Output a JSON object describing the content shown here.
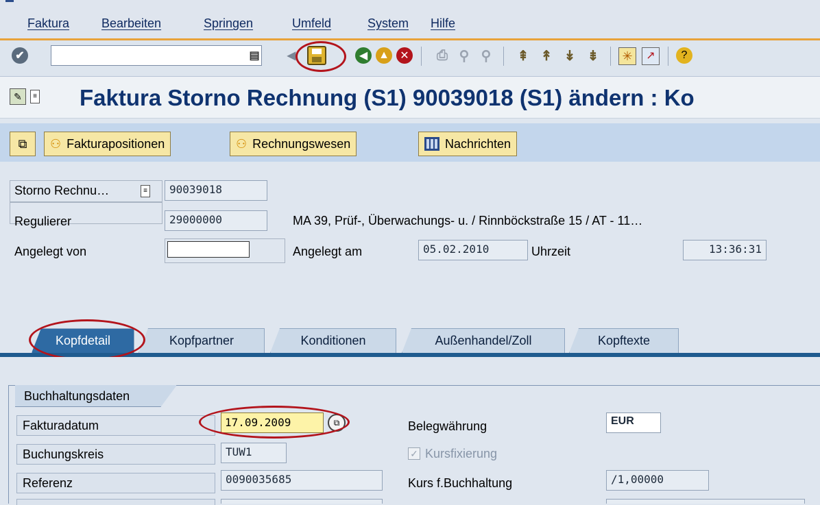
{
  "menu": {
    "items": [
      "Faktura",
      "Bearbeiten",
      "Springen",
      "Umfeld",
      "System",
      "Hilfe"
    ]
  },
  "toolbar": {
    "command_field": "",
    "icons": [
      "enter-icon",
      "back-icon",
      "save-icon",
      "back-nav-icon",
      "exit-icon",
      "cancel-icon",
      "print-icon",
      "find-icon",
      "find-next-icon",
      "first-page-icon",
      "prev-page-icon",
      "next-page-icon",
      "last-page-icon",
      "new-session-icon",
      "shortcut-icon",
      "help-icon"
    ]
  },
  "title": {
    "text": "Faktura Storno Rechnung (S1) 90039018   (S1) ändern : Ko"
  },
  "app_toolbar": {
    "fakturapositionen": "Fakturapositionen",
    "rechnungswesen": "Rechnungswesen",
    "nachrichten": "Nachrichten"
  },
  "header": {
    "doc_type_label": "Storno Rechnu…",
    "doc_number": "90039018",
    "payer_label": "Regulierer",
    "payer_value": "29000000",
    "payer_address": "MA 39, Prüf-, Überwachungs- u. / Rinnböckstraße 15 / AT - 11…",
    "created_by_label": "Angelegt von",
    "created_by_value": "",
    "created_on_label": "Angelegt am",
    "created_on_value": "05.02.2010",
    "time_label": "Uhrzeit",
    "time_value": "13:36:31"
  },
  "tabs": [
    "Kopfdetail",
    "Kopfpartner",
    "Konditionen",
    "Außenhandel/Zoll",
    "Kopftexte"
  ],
  "accounting": {
    "group_title": "Buchhaltungsdaten",
    "billing_date_label": "Fakturadatum",
    "billing_date_value": "17.09.2009",
    "company_code_label": "Buchungskreis",
    "company_code_value": "TUW1",
    "reference_label": "Referenz",
    "reference_value": "0090035685",
    "currency_label": "Belegwährung",
    "currency_value": "EUR",
    "fixed_rate_label": "Kursfixierung",
    "rate_label": "Kurs f.Buchhaltung",
    "rate_value": "/1,00000"
  },
  "colors": {
    "title_blue": "#0f3370",
    "highlight_red": "#b3141c",
    "tab_active": "#2e6aa3",
    "button_yellow": "#f6e7a5",
    "menu_underline_orange": "#e8a23a"
  }
}
